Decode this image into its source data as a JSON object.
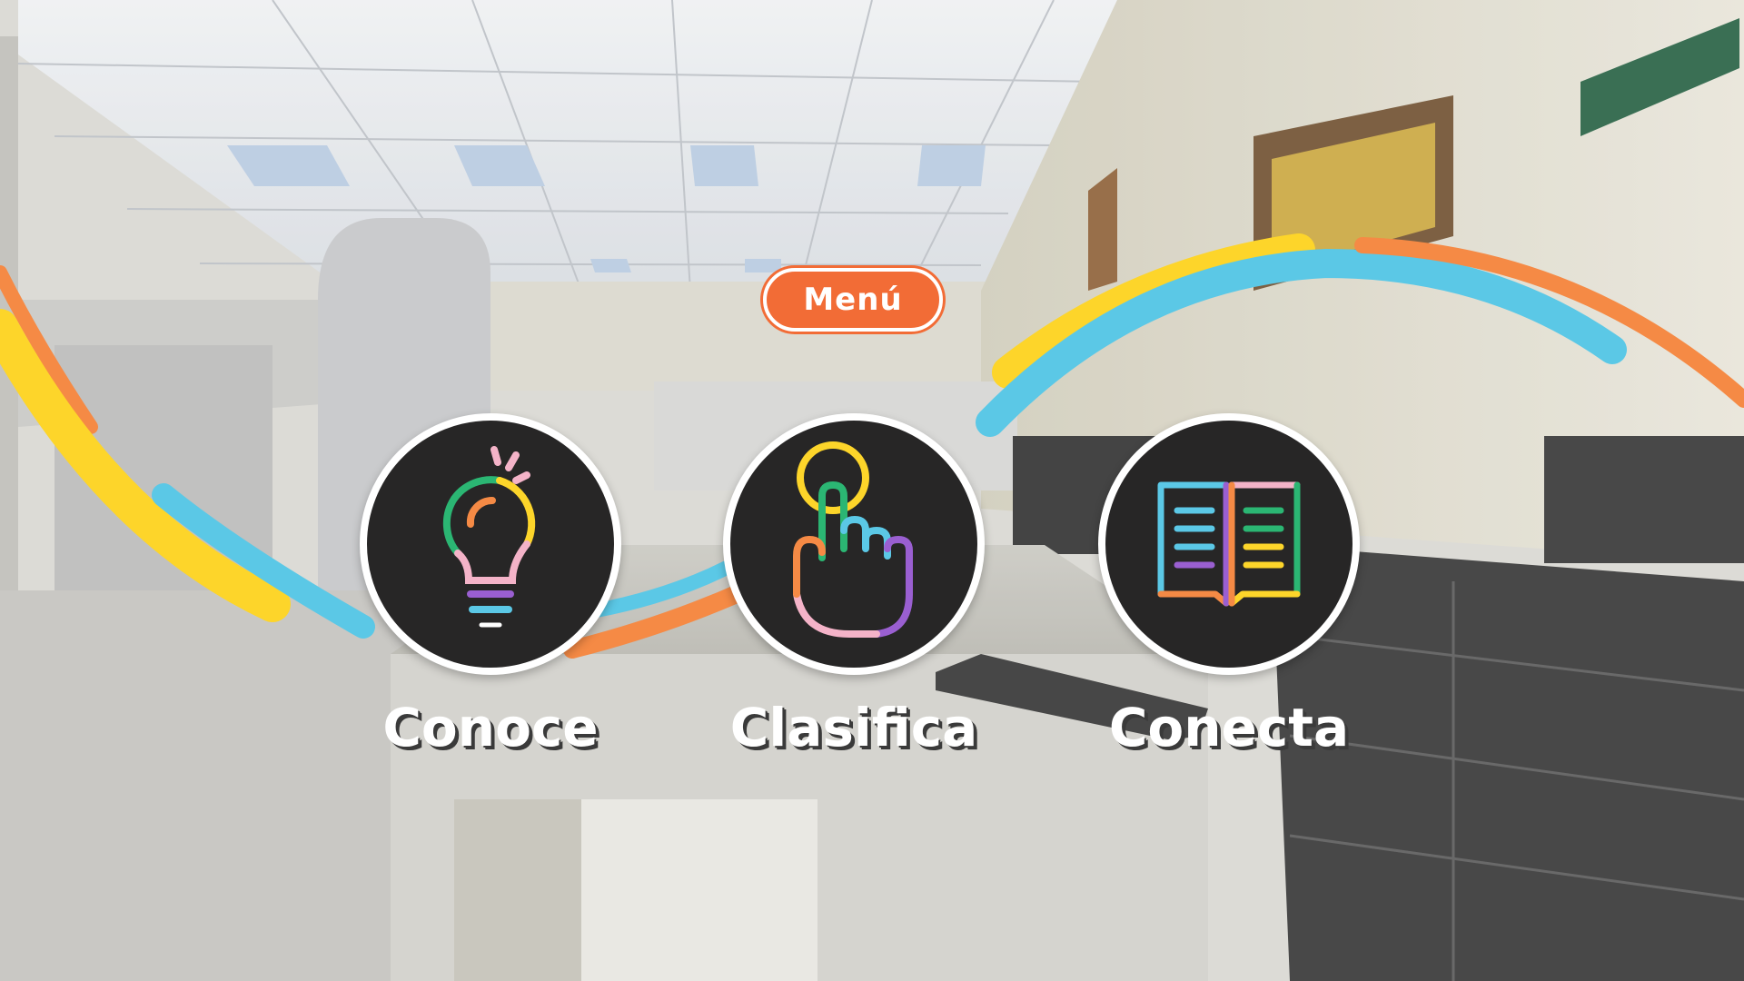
{
  "menu": {
    "label": "Menú"
  },
  "options": [
    {
      "label": "Conoce",
      "icon": "lightbulb-icon"
    },
    {
      "label": "Clasifica",
      "icon": "tap-hand-icon"
    },
    {
      "label": "Conecta",
      "icon": "open-book-icon"
    }
  ],
  "colors": {
    "accent": "#f26c36",
    "yellow": "#fdd52a",
    "blue": "#5bc8e6",
    "orange": "#f58a45",
    "green": "#2bb673",
    "purple": "#9a5fd1",
    "pink": "#f4b3c8",
    "disc": "#272626"
  }
}
